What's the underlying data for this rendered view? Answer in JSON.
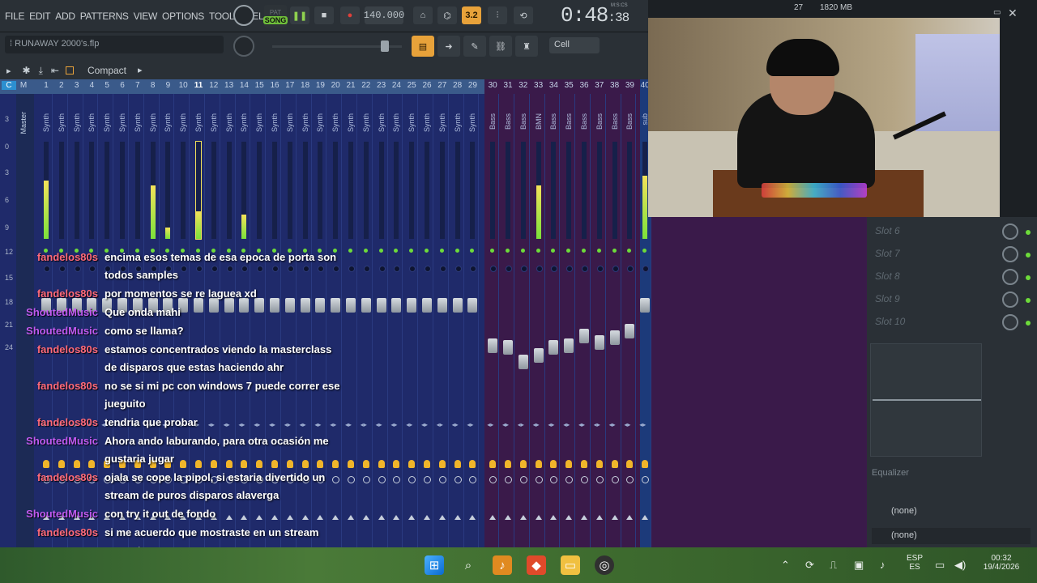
{
  "menu": {
    "items": [
      "FILE",
      "EDIT",
      "ADD",
      "PATTERNS",
      "VIEW",
      "OPTIONS",
      "TOOLS",
      "HELP"
    ]
  },
  "transport": {
    "pat_label": "PAT",
    "song_label": "SONG",
    "tempo": "140.000",
    "time": "0:48",
    "time_small": ":38",
    "time_unit": "M:S:CS",
    "cpu": "27",
    "memory": "1820 MB",
    "snap_value": "3.2"
  },
  "project": {
    "filename": "RUNAWAY 2000's.flp",
    "snap_mode": "Cell"
  },
  "mixer": {
    "view_mode": "Compact",
    "header_cm": [
      "C",
      "M"
    ],
    "master_label": "Master",
    "track_numbers": [
      "1",
      "2",
      "3",
      "4",
      "5",
      "6",
      "7",
      "8",
      "9",
      "10",
      "11",
      "12",
      "13",
      "14",
      "15",
      "16",
      "17",
      "18",
      "19",
      "20",
      "21",
      "22",
      "23",
      "24",
      "25",
      "26",
      "27",
      "28",
      "29",
      "30",
      "31",
      "32",
      "33",
      "34",
      "35",
      "36",
      "37",
      "38",
      "39",
      "40"
    ],
    "selected_track": "11",
    "synth_label": "Synth",
    "bass_label": "Bass",
    "bass_special_label": "BMN",
    "sub_label": "sub",
    "scale": [
      "3",
      "0",
      "3",
      "6",
      "9",
      "12",
      "15",
      "18",
      "21",
      "24"
    ],
    "meter_levels": {
      "1": 0.6,
      "8": 0.55,
      "9": 0.12,
      "11": 0.28,
      "14": 0.25,
      "33": 0.55,
      "40": 0.65
    }
  },
  "right_panel": {
    "slots": [
      "Slot 6",
      "Slot 7",
      "Slot 8",
      "Slot 9",
      "Slot 10"
    ],
    "equalizer_label": "Equalizer",
    "send1": "(none)",
    "send2": "(none)"
  },
  "chat": [
    {
      "user": "fandelos80s",
      "color": "#ff6a7a",
      "lines": [
        "encima esos temas de esa epoca de porta son",
        "todos samples"
      ]
    },
    {
      "user": "fandelos80s",
      "color": "#ff6a7a",
      "lines": [
        "por momentos se re laguea xd"
      ]
    },
    {
      "user": "ShoutedMusic",
      "color": "#c05af0",
      "lines": [
        "Que onda mahi"
      ]
    },
    {
      "user": "ShoutedMusic",
      "color": "#c05af0",
      "lines": [
        "como se llama?"
      ]
    },
    {
      "user": "fandelos80s",
      "color": "#ff6a7a",
      "lines": [
        "estamos concentrados viendo la masterclass",
        "de disparos que estas haciendo ahr"
      ]
    },
    {
      "user": "fandelos80s",
      "color": "#ff6a7a",
      "lines": [
        "no se si mi pc con windows 7 puede correr ese",
        "jueguito"
      ]
    },
    {
      "user": "fandelos80s",
      "color": "#ff6a7a",
      "lines": [
        "tendria que probar"
      ]
    },
    {
      "user": "ShoutedMusic",
      "color": "#c05af0",
      "lines": [
        "Ahora ando laburando, para otra ocasión me",
        "gustaria jugar"
      ]
    },
    {
      "user": "fandelos80s",
      "color": "#ff6a7a",
      "lines": [
        "ojala se cope la pipol, si estaria divertido un",
        "stream de puros disparos alaverga"
      ]
    },
    {
      "user": "ShoutedMusic",
      "color": "#c05af0",
      "lines": [
        "con try it out de fondo"
      ]
    },
    {
      "user": "fandelos80s",
      "color": "#ff6a7a",
      "lines": [
        "si me acuerdo que mostraste en un stream",
        "esos stems"
      ]
    }
  ],
  "taskbar": {
    "lang_top": "ESP",
    "lang_bottom": "ES",
    "time": "00:32",
    "date": "19/4/2026"
  },
  "colors": {
    "accent_green": "#6ddb3a",
    "synth_strip": "#1f2a6a",
    "bass_strip": "#3a1a4a",
    "meter_yellow": "#f4e25a"
  }
}
